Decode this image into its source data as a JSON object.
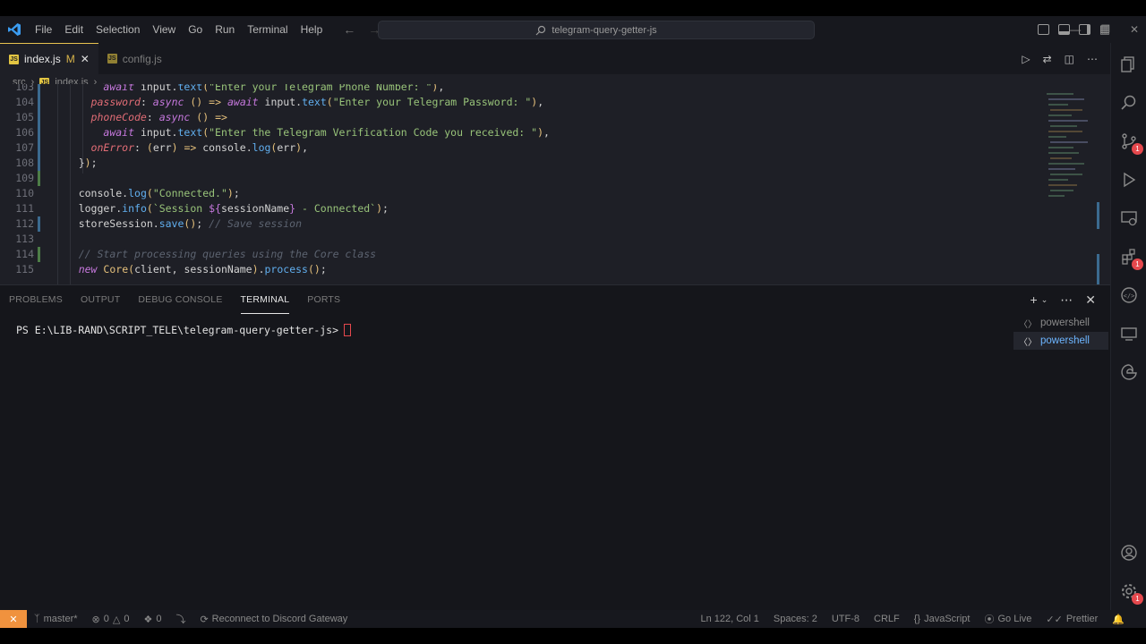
{
  "menu": [
    "File",
    "Edit",
    "Selection",
    "View",
    "Go",
    "Run",
    "Terminal",
    "Help"
  ],
  "search": {
    "text": "telegram-query-getter-js"
  },
  "tabs": [
    {
      "label": "index.js",
      "modified": "M",
      "active": true
    },
    {
      "label": "config.js",
      "active": false
    }
  ],
  "breadcrumb": {
    "folder": "src",
    "file": "index.js",
    "more": "..."
  },
  "editor": {
    "lines": [
      {
        "num": "103",
        "text": "        await input.text(\"Enter your Telegram Phone Number: \"),",
        "mark": "mod"
      },
      {
        "num": "104",
        "text": "      password: async () => await input.text(\"Enter your Telegram Password: \"),",
        "mark": "mod"
      },
      {
        "num": "105",
        "text": "      phoneCode: async () =>",
        "mark": "mod"
      },
      {
        "num": "106",
        "text": "        await input.text(\"Enter the Telegram Verification Code you received: \"),",
        "mark": "mod"
      },
      {
        "num": "107",
        "text": "      onError: (err) => console.log(err),",
        "mark": "mod"
      },
      {
        "num": "108",
        "text": "    });",
        "mark": "mod"
      },
      {
        "num": "109",
        "text": "",
        "mark": "add"
      },
      {
        "num": "110",
        "text": "    console.log(\"Connected.\");",
        "mark": "none"
      },
      {
        "num": "111",
        "text": "    logger.info(`Session ${sessionName} - Connected`);",
        "mark": "none"
      },
      {
        "num": "112",
        "text": "    storeSession.save(); // Save session",
        "mark": "mod"
      },
      {
        "num": "113",
        "text": "",
        "mark": "none"
      },
      {
        "num": "114",
        "text": "    // Start processing queries using the Core class",
        "mark": "add"
      },
      {
        "num": "115",
        "text": "    new Core(client, sessionName).process();",
        "mark": "none"
      }
    ]
  },
  "panel": {
    "tabs": [
      "PROBLEMS",
      "OUTPUT",
      "DEBUG CONSOLE",
      "TERMINAL",
      "PORTS"
    ],
    "active_tab": "TERMINAL",
    "prompt": "PS E:\\LIB-RAND\\SCRIPT_TELE\\telegram-query-getter-js>",
    "terminals": [
      "powershell",
      "powershell"
    ]
  },
  "activity_badges": {
    "source_control": "1",
    "extensions": "1",
    "settings": "1"
  },
  "statusbar": {
    "branch": "master*",
    "errors": "0",
    "warnings": "0",
    "ports": "0",
    "discord": "Reconnect to Discord Gateway",
    "position": "Ln 122, Col 1",
    "spaces": "Spaces: 2",
    "encoding": "UTF-8",
    "eol": "CRLF",
    "language": "JavaScript",
    "golive": "Go Live",
    "prettier": "Prettier"
  },
  "colors": {
    "accent_tab": "#e8c34f",
    "remote": "#f0923e",
    "badge": "#e5484d",
    "terminal_active": "#6db5ff"
  }
}
